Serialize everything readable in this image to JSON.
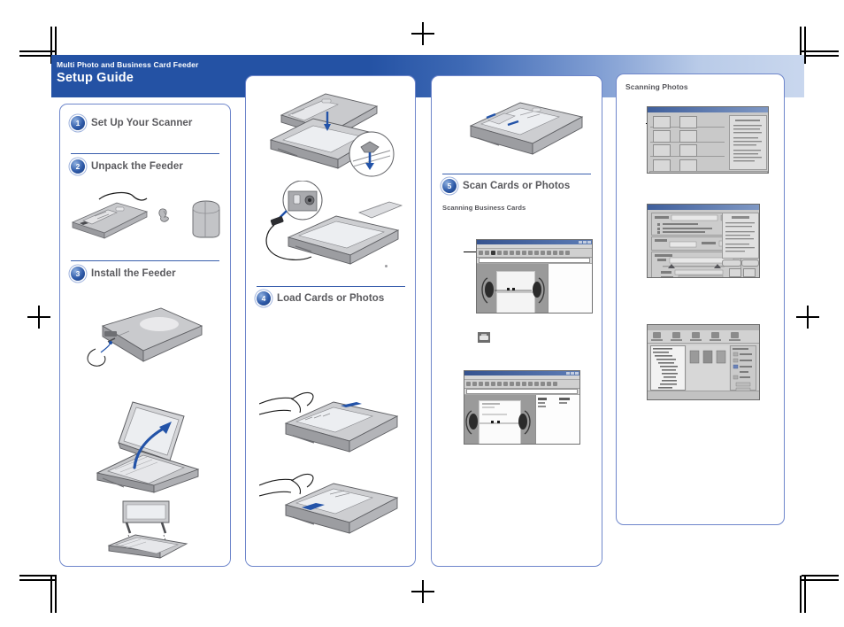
{
  "document": {
    "banner": {
      "subtitle": "Multi Photo and Business Card Feeder",
      "title": "Setup Guide",
      "bg_start": "#2452a4",
      "bg_end": "#c9d7ee"
    },
    "accent_color": "#3a5fad",
    "step_text_color": "#5a5a5e"
  },
  "columns": [
    {
      "id": "column-1",
      "steps": [
        {
          "number": "1",
          "label": "Set Up Your Scanner"
        },
        {
          "number": "2",
          "label": "Unpack the Feeder"
        },
        {
          "number": "3",
          "label": "Install the Feeder"
        }
      ],
      "illustrations": [
        {
          "name": "feeder-parts-illustration"
        },
        {
          "name": "scanner-cable-illustration"
        },
        {
          "name": "scanner-lid-open-illustration"
        },
        {
          "name": "lid-removal-illustration"
        }
      ]
    },
    {
      "id": "column-2",
      "steps": [
        {
          "number": "4",
          "label": "Load Cards or Photos"
        }
      ],
      "illustrations": [
        {
          "name": "attach-feeder-illustration"
        },
        {
          "name": "connect-feeder-cable-illustration"
        },
        {
          "name": "load-cards-hand-illustration"
        },
        {
          "name": "load-photos-hand-illustration"
        }
      ]
    },
    {
      "id": "column-3",
      "steps": [
        {
          "number": "5",
          "label": "Scan Cards or Photos"
        }
      ],
      "subheading": "Scanning Business Cards",
      "illustrations": [
        {
          "name": "feeder-on-scanner-illustration"
        },
        {
          "name": "scan-toolbar-icon"
        }
      ],
      "screenshots": [
        {
          "name": "business-card-scan-window"
        },
        {
          "name": "business-card-results-window"
        }
      ]
    },
    {
      "id": "column-4",
      "subheading": "Scanning Photos",
      "screenshots": [
        {
          "name": "epson-smart-panel-window"
        },
        {
          "name": "save-file-settings-dialog"
        },
        {
          "name": "photo-browser-window"
        }
      ]
    }
  ],
  "print_marks": {
    "crop_marks": 4,
    "registration_marks": 4
  }
}
